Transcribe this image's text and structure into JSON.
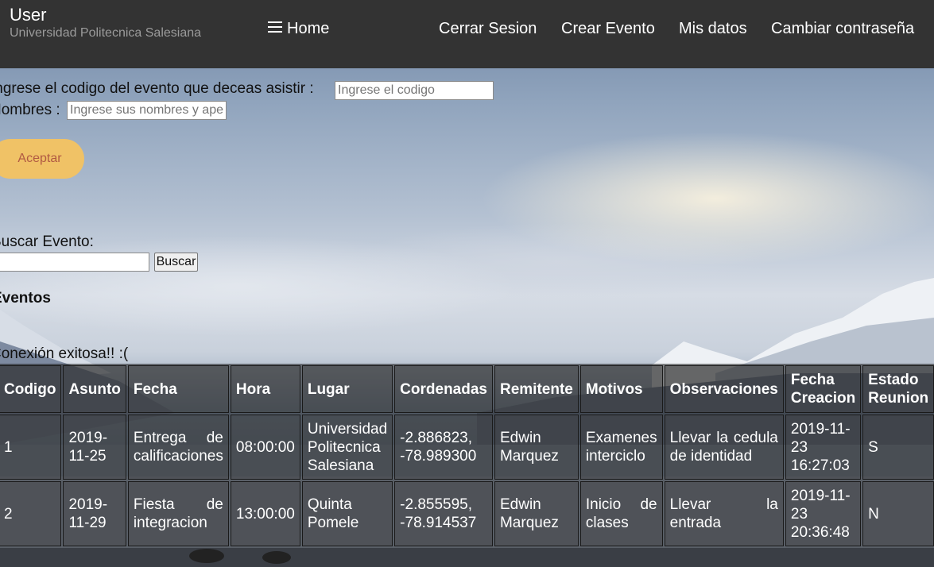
{
  "header": {
    "title": "User",
    "subtitle": "Universidad Politecnica Salesiana",
    "home_label": "Home",
    "nav": [
      "Cerrar Sesion",
      "Crear Evento",
      "Mis datos",
      "Cambiar contraseña"
    ],
    "menu_icon": "hamburger-icon"
  },
  "form": {
    "code_label": "Ingrese el codigo del evento que deceas asistir :",
    "code_placeholder": "Ingrese el codigo",
    "names_label": "Nombres :",
    "names_placeholder": "Ingrese sus nombres y ape",
    "accept_label": "Aceptar"
  },
  "search": {
    "label": "Buscar Evento:",
    "value": "",
    "button_label": "Buscar"
  },
  "events": {
    "title": "Eventos",
    "status_message": "Conexión exitosa!! :(",
    "headers": [
      "Codigo",
      "Asunto",
      "Fecha",
      "Hora",
      "Lugar",
      "Cordenadas",
      "Remitente",
      "Motivos",
      "Observaciones",
      "Fecha Creacion",
      "Estado Reunion"
    ],
    "rows": [
      [
        "1",
        "2019-11-25",
        "Entrega de calificaciones",
        "08:00:00",
        "Universidad Politecnica Salesiana",
        "-2.886823, -78.989300",
        "Edwin Marquez",
        "Examenes interciclo",
        "Llevar la cedula de identidad",
        "2019-11-23 16:27:03",
        "S"
      ],
      [
        "2",
        "2019-11-29",
        "Fiesta de integracion",
        "13:00:00",
        "Quinta Pomele",
        "-2.855595, -78.914537",
        "Edwin Marquez",
        "Inicio de clases",
        "Llevar la entrada",
        "2019-11-23 20:36:48",
        "N"
      ]
    ]
  },
  "colors": {
    "topbar": "#333333",
    "accept_button": "#f0c266",
    "accept_text": "#b15a43"
  }
}
